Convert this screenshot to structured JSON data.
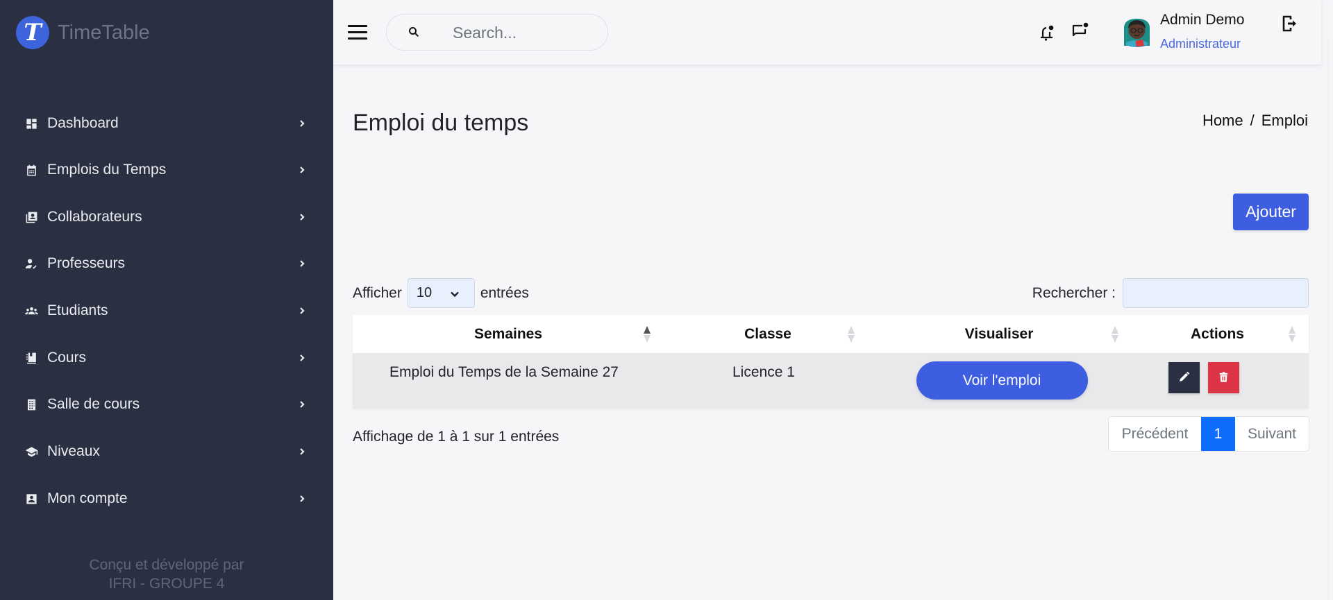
{
  "app": {
    "logo_letter": "T",
    "name": "TimeTable",
    "brand_color": "#3d63dd"
  },
  "sidebar": {
    "items": [
      {
        "label": "Dashboard",
        "icon": "dashboard-icon"
      },
      {
        "label": "Emplois du Temps",
        "icon": "calendar-icon"
      },
      {
        "label": "Collaborateurs",
        "icon": "contacts-icon"
      },
      {
        "label": "Professeurs",
        "icon": "person-check-icon"
      },
      {
        "label": "Etudiants",
        "icon": "group-icon"
      },
      {
        "label": "Cours",
        "icon": "notebook-icon"
      },
      {
        "label": "Salle de cours",
        "icon": "building-icon"
      },
      {
        "label": "Niveaux",
        "icon": "graduation-cap-icon"
      },
      {
        "label": "Mon compte",
        "icon": "account-box-icon"
      }
    ],
    "footer_line1": "Conçu et développé par",
    "footer_line2": "IFRI - GROUPE 4"
  },
  "header": {
    "search_placeholder": "Search...",
    "search_value": "",
    "user_name": "Admin Demo",
    "user_role": "Administrateur"
  },
  "page": {
    "title": "Emploi du temps",
    "breadcrumb": [
      "Home",
      "/",
      "Emploi"
    ],
    "add_button": "Ajouter"
  },
  "table_controls": {
    "show_label": "Afficher",
    "page_size": "10",
    "entries_label": "entrées",
    "search_label": "Rechercher :",
    "search_value": ""
  },
  "table": {
    "columns": [
      "Semaines",
      "Classe",
      "Visualiser",
      "Actions"
    ],
    "sorted_column": "Semaines",
    "sort_direction": "asc",
    "rows": [
      {
        "semaine": "Emploi du Temps de la Semaine 27",
        "classe": "Licence 1",
        "visualiser": "Voir l'emploi"
      }
    ]
  },
  "footer": {
    "info": "Affichage de 1 à 1 sur 1 entrées",
    "prev": "Précédent",
    "current_page": "1",
    "next": "Suivant"
  }
}
